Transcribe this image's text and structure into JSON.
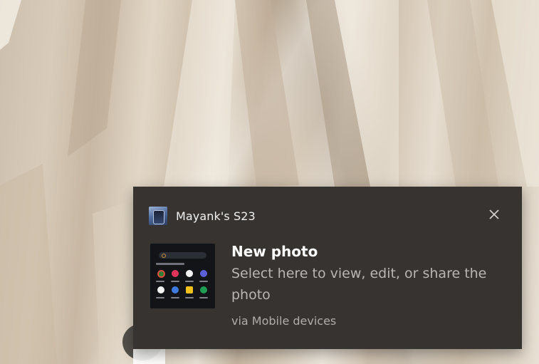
{
  "notification": {
    "app_name": "Mayank's S23",
    "title": "New photo",
    "body": "Select here to view, edit, or share the photo",
    "attribution": "via Mobile devices",
    "close_icon": "close-icon",
    "app_icon": "phone-app-icon",
    "thumbnail": "phone-screenshot-thumbnail",
    "background_color": "#363330"
  },
  "desktop": {
    "wallpaper": "sandstone-rock-wallpaper"
  }
}
